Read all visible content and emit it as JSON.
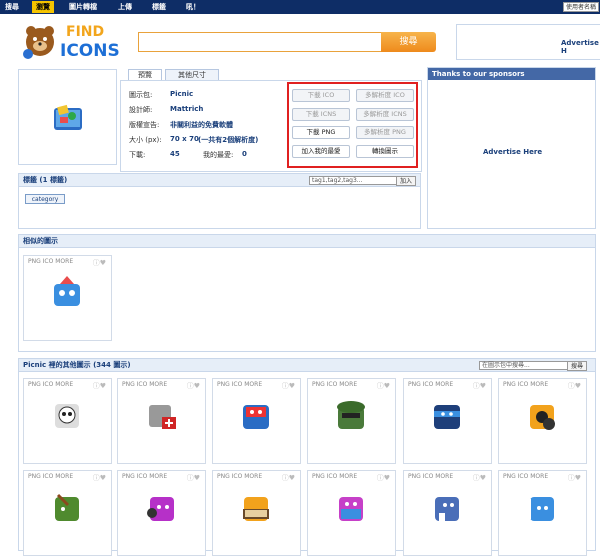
{
  "topnav": {
    "items": [
      "搜尋",
      "瀏覽",
      "圖片轉檔",
      "上傳",
      "標籤",
      "吼！"
    ],
    "login": "使用者名稱"
  },
  "logo": {
    "text_find": "FIND",
    "text_icons": "ICONS"
  },
  "search": {
    "button": "搜尋"
  },
  "ad_top": "Advertise H",
  "tabs": [
    "預覽",
    "其他尺寸"
  ],
  "info": {
    "labels": [
      "圖示包:",
      "設計師:",
      "版權宣告:",
      "大小 (px):",
      "下載:"
    ],
    "pack": "Picnic",
    "designer": "Mattrich",
    "license": "非關利益的免費軟體",
    "size": "70 x 70",
    "size_link": "(一共有2個解析度)",
    "downloads": "45",
    "fav_label": "我的最愛:",
    "fav": "0"
  },
  "buttons": [
    "下載 ICO",
    "多解析度 ICO",
    "下載 ICNS",
    "多解析度 ICNS",
    "下載 PNG",
    "多解析度 PNG",
    "加入我的最愛",
    "轉換圖示"
  ],
  "sponsor": {
    "title": "Thanks to our sponsors",
    "ad": "Advertise Here"
  },
  "tags": {
    "title": "標籤 (1 標籤)",
    "placeholder": "tag1,tag2,tag3...",
    "add": "加入",
    "category": "category"
  },
  "similar": {
    "title": "相似的圖示",
    "card_label": "PNG ICO MORE"
  },
  "others": {
    "title": "Picnic 裡的其他圖示 (344 圖示)",
    "search_placeholder": "在圖示包中搜尋...",
    "search_btn": "搜尋",
    "card_label": "PNG ICO MORE"
  }
}
